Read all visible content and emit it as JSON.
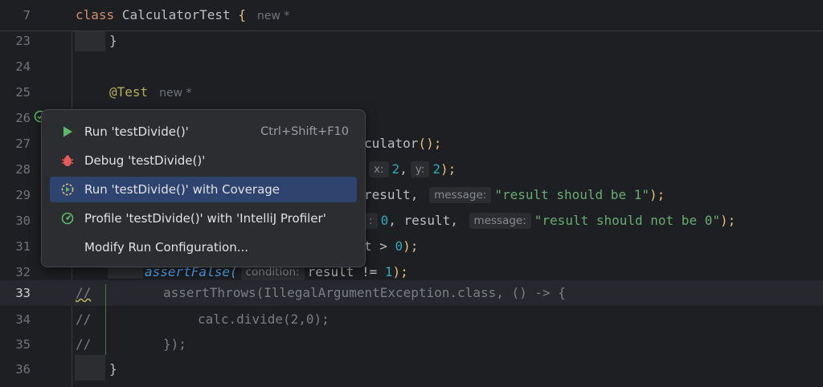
{
  "sticky_header": {
    "line_no": "7",
    "keyword": "class",
    "class_name": "CalculatorTest",
    "brace": "{",
    "new_marker": "new *"
  },
  "lines": {
    "l23": {
      "no": "23",
      "text": "}"
    },
    "l24": {
      "no": "24"
    },
    "l25": {
      "no": "25",
      "annotation": "@Test",
      "new_marker": "new *"
    },
    "l26": {
      "no": "26"
    },
    "l27": {
      "no": "27",
      "tail": "culator",
      "tail_end": "();"
    },
    "l28": {
      "no": "28",
      "hint_x": "x:",
      "v1": "2",
      "comma": ",",
      "hint_y": "y:",
      "v2": "2",
      "end": ");"
    },
    "l29": {
      "no": "29",
      "tail": "result,",
      "hint": "message:",
      "str": "\"result should be 1\"",
      "end": ");"
    },
    "l30": {
      "no": "30",
      "hint_frag": ":",
      "zero": "0",
      "mid": ", result,",
      "hint": "message:",
      "str": "\"result should not be 0\"",
      "end": ");"
    },
    "l31": {
      "no": "31",
      "tail": "t > ",
      "zero": "0",
      "end": ");"
    },
    "l32": {
      "no": "32",
      "fn": "assertFalse(",
      "hint": "condition:",
      "tail": "result != ",
      "one": "1",
      "end": ");"
    },
    "l33": {
      "no": "33",
      "comment": "//",
      "code": "assertThrows(IllegalArgumentException.class, () -> {"
    },
    "l34": {
      "no": "34",
      "comment": "//",
      "code": "calc.divide(2,0);"
    },
    "l35": {
      "no": "35",
      "comment": "//",
      "code": "});"
    },
    "l36": {
      "no": "36",
      "text": "}"
    }
  },
  "popup": {
    "items": [
      {
        "label": "Run 'testDivide()'",
        "shortcut": "Ctrl+Shift+F10",
        "icon": "run-icon"
      },
      {
        "label": "Debug 'testDivide()'",
        "icon": "debug-icon"
      },
      {
        "label": "Run 'testDivide()' with Coverage",
        "icon": "coverage-icon",
        "selected": true
      },
      {
        "label": "Profile 'testDivide()' with 'IntelliJ Profiler'",
        "icon": "profiler-icon"
      },
      {
        "label": "Modify Run Configuration..."
      }
    ]
  },
  "colors": {
    "background": "#1e1f22",
    "selection": "#2e436e",
    "run_green": "#5fb865",
    "debug_red": "#e55b5b"
  }
}
